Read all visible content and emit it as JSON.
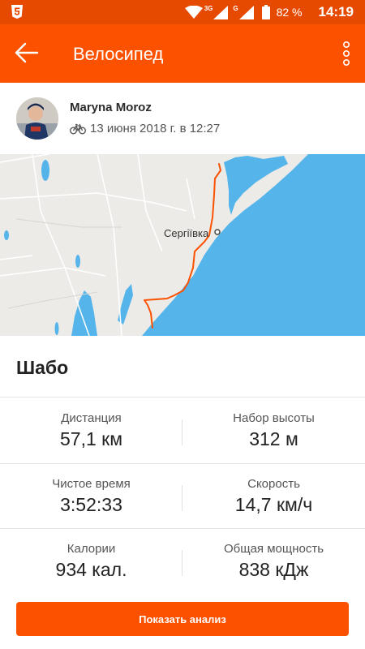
{
  "status_bar": {
    "network": "3G",
    "network2": "G",
    "battery": "82 %",
    "time": "14:19"
  },
  "appbar": {
    "title": "Велосипед"
  },
  "athlete": {
    "name": "Maryna Moroz",
    "date": "13 июня 2018 г. в 12:27"
  },
  "map": {
    "place_label": "Сергіївка"
  },
  "activity": {
    "title": "Шабо"
  },
  "stats": [
    {
      "label": "Дистанция",
      "value": "57,1 км"
    },
    {
      "label": "Набор высоты",
      "value": "312 м"
    },
    {
      "label": "Чистое время",
      "value": "3:52:33"
    },
    {
      "label": "Скорость",
      "value": "14,7 км/ч"
    },
    {
      "label": "Калории",
      "value": "934 кал."
    },
    {
      "label": "Общая мощность",
      "value": "838 кДж"
    }
  ],
  "actions": {
    "show_analysis": "Показать анализ"
  },
  "colors": {
    "brand": "#fc5200",
    "status_bar": "#e64a00",
    "water": "#55b4ea",
    "land": "#ecebe8",
    "route": "#fc5200"
  },
  "icons": [
    "html5-icon",
    "wifi-icon",
    "signal-icon",
    "battery-icon",
    "back-arrow-icon",
    "more-vert-icon",
    "bike-icon"
  ]
}
